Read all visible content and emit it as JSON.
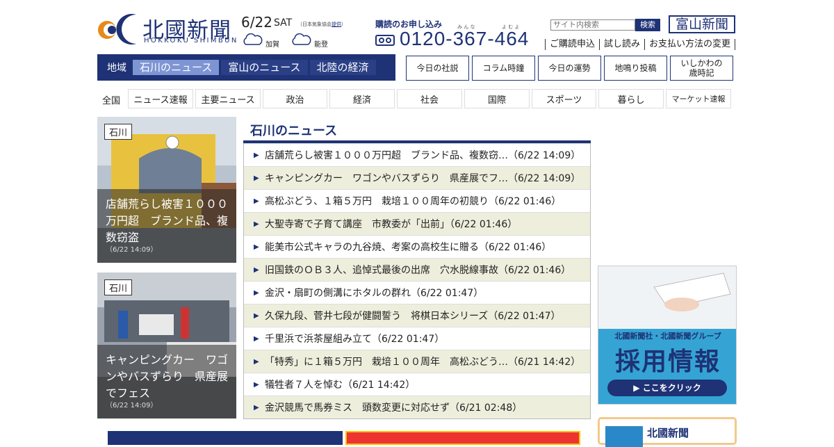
{
  "header": {
    "logo_text": "北國新聞",
    "logo_sub": "HOKKOKU SHIMBUN",
    "date": "6/22",
    "day_of_week": "SAT",
    "weather_source_prefix": "（日本気象協会",
    "weather_source_link": "提供",
    "weather_source_suffix": "）",
    "weather": [
      {
        "area": "加賀",
        "icon": "cloud-icon"
      },
      {
        "area": "能登",
        "icon": "cloud-icon"
      }
    ],
    "subscribe_title": "購読のお申し込み",
    "ruby_minna": "み ん な",
    "ruby_yomu": "よ む よ",
    "phone": "0120-367-464",
    "search_placeholder": "サイト内検索",
    "search_button": "検索",
    "toyama_logo": "富山新聞",
    "top_links": [
      "ご購読申込",
      "試し読み",
      "お支払い方法の変更"
    ]
  },
  "region_nav": {
    "label": "地域",
    "tabs": [
      "石川のニュース",
      "富山のニュース",
      "北陸の経済"
    ],
    "active": 0
  },
  "box_links": [
    "今日の社説",
    "コラム時鐘",
    "今日の運勢",
    "地鳴り投稿",
    "いしかわの\n歳時記"
  ],
  "category_nav": {
    "label": "全国",
    "items": [
      "ニュース速報",
      "主要ニュース",
      "政治",
      "経済",
      "社会",
      "国際",
      "スポーツ",
      "暮らし",
      "マーケット速報"
    ]
  },
  "cards": [
    {
      "tag": "石川",
      "title": "店舗荒らし被害１０００万円超　ブランド品、複数窃盗",
      "time": "（6/22 14:09）"
    },
    {
      "tag": "石川",
      "title": "キャンピングカー　ワゴンやバスずらり　県産展でフェス",
      "time": "（6/22 14:09）"
    }
  ],
  "news": {
    "title": "石川のニュース",
    "items": [
      "店舗荒らし被害１０００万円超　ブランド品、複数窃…（6/22 14:09）",
      "キャンピングカー　ワゴンやバスずらり　県産展でフ…（6/22 14:09）",
      "高松ぶどう、１箱５万円　栽培１００周年の初競り（6/22 01:46）",
      "大聖寺寄で子育て講座　市教委が「出前」（6/22 01:46）",
      "能美市公式キャラの九谷焼、考案の高校生に贈る（6/22 01:46）",
      "旧国鉄のＯＢ３人、追悼式最後の出席　穴水脱線事故（6/22 01:46）",
      "金沢・扇町の側溝にホタルの群れ（6/22 01:47）",
      "久保九段、菅井七段が健闘誓う　将棋日本シリーズ（6/22 01:47）",
      "千里浜で浜茶屋組み立て（6/22 01:47）",
      "「特秀」に１箱５万円　栽培１００周年　高松ぶどう…（6/21 14:42）",
      "犠牲者７人を悼む（6/21 14:42）",
      "金沢競馬で馬券ミス　頭数変更に対応せず（6/21 02:48）"
    ]
  },
  "ads": {
    "recruit_line1": "北國新聞社・北國新聞グループ",
    "recruit_title": "採用情報",
    "recruit_button": "▶ ここをクリック",
    "hokkoku_label": "北國新聞"
  },
  "colors": {
    "brand": "#1e3275",
    "accent_tab": "#7e95d4",
    "stripe": "#eeeedd"
  }
}
